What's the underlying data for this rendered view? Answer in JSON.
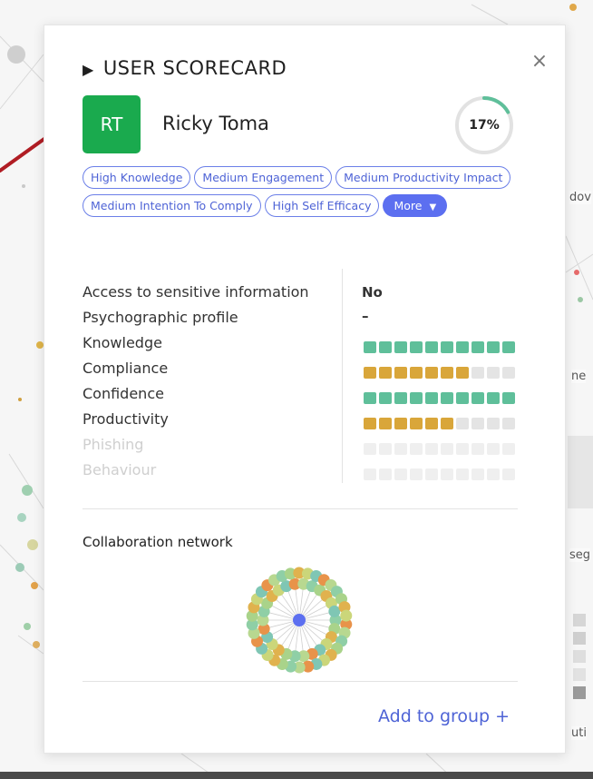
{
  "backdrop": {
    "fragments": [
      "dov",
      "ne",
      "seg",
      "uti"
    ]
  },
  "scorecard": {
    "title": "USER SCORECARD",
    "close_symbol": "×",
    "user": {
      "initials": "RT",
      "name": "Ricky Toma"
    },
    "score": {
      "label": "17%",
      "fraction": 0.17
    },
    "tags": [
      "High Knowledge",
      "Medium Engagement",
      "Medium Productivity Impact",
      "Medium Intention To Comply",
      "High Self Efficacy"
    ],
    "more_label": "More",
    "more_icon": "▼",
    "metrics": [
      {
        "label": "Access to sensitive information",
        "value": "No"
      },
      {
        "label": "Psychographic profile",
        "value": "–"
      },
      {
        "label": "Knowledge",
        "filled": 10,
        "total": 10,
        "color": "#5fbf9a"
      },
      {
        "label": "Compliance",
        "filled": 7,
        "total": 10,
        "color": "#d9a63a"
      },
      {
        "label": "Confidence",
        "filled": 10,
        "total": 10,
        "color": "#5fbf9a"
      },
      {
        "label": "Productivity",
        "filled": 6,
        "total": 10,
        "color": "#d9a63a"
      },
      {
        "label": "Phishing",
        "filled": 0,
        "total": 10,
        "faded": true
      },
      {
        "label": "Behaviour",
        "filled": 0,
        "total": 10,
        "faded": true
      }
    ],
    "collaboration_title": "Collaboration network",
    "add_group_label": "Add to group +"
  },
  "colors": {
    "avatar": "#1aaa4e",
    "accent": "#5c6ff0",
    "good": "#5fbf9a",
    "medium": "#d9a63a",
    "empty": "#e4e4e4",
    "score_ring": "#5fbf9a",
    "pointer": "#b01d24"
  }
}
